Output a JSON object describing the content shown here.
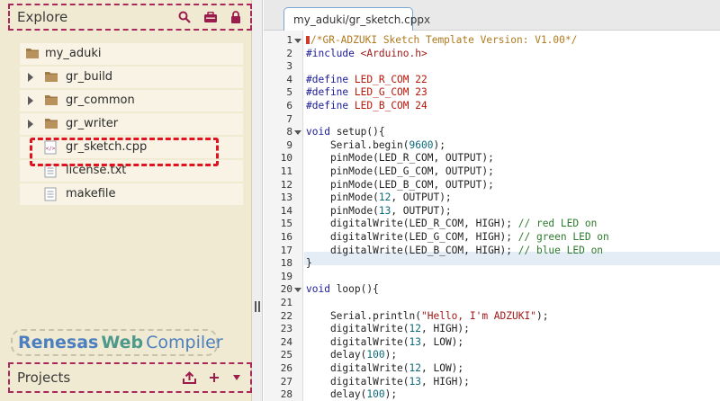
{
  "explore": {
    "title": "Explore",
    "icons": [
      "search-icon",
      "toolbox-icon",
      "lock-icon"
    ]
  },
  "tree": [
    {
      "label": "my_aduki",
      "type": "folder",
      "level": 0,
      "expandable": false
    },
    {
      "label": "gr_build",
      "type": "folder",
      "level": 1,
      "expandable": true
    },
    {
      "label": "gr_common",
      "type": "folder",
      "level": 1,
      "expandable": true
    },
    {
      "label": "gr_writer",
      "type": "folder",
      "level": 1,
      "expandable": true
    },
    {
      "label": "gr_sketch.cpp",
      "type": "code-file",
      "level": 1,
      "expandable": false
    },
    {
      "label": "license.txt",
      "type": "text-file",
      "level": 1,
      "expandable": false
    },
    {
      "label": "makefile",
      "type": "text-file",
      "level": 1,
      "expandable": false
    }
  ],
  "brand": {
    "word1": "Renesas",
    "word2": "Web",
    "word3": "Compiler"
  },
  "projects": {
    "title": "Projects",
    "icons": [
      "upload-icon",
      "plus-icon",
      "dropdown-icon"
    ]
  },
  "editor": {
    "tab_label": "my_aduki/gr_sketch.cpp",
    "tab_close": "x",
    "line_numbers": [
      "1",
      "2",
      "3",
      "4",
      "5",
      "6",
      "7",
      "8",
      "9",
      "10",
      "11",
      "12",
      "13",
      "14",
      "15",
      "16",
      "17",
      "18",
      "19",
      "20",
      "21",
      "22",
      "23",
      "24",
      "25",
      "26",
      "27",
      "28"
    ],
    "fold_lines": [
      "1",
      "8",
      "20"
    ],
    "lines": [
      "/*GR-ADZUKI Sketch Template Version: V1.00*/",
      "#include <Arduino.h>",
      "",
      "#define LED_R_COM 22",
      "#define LED_G_COM 23",
      "#define LED_B_COM 24",
      "",
      "void setup(){",
      "    Serial.begin(9600);",
      "    pinMode(LED_R_COM, OUTPUT);",
      "    pinMode(LED_G_COM, OUTPUT);",
      "    pinMode(LED_B_COM, OUTPUT);",
      "    pinMode(12, OUTPUT);",
      "    pinMode(13, OUTPUT);",
      "    digitalWrite(LED_R_COM, HIGH); // red LED on",
      "    digitalWrite(LED_G_COM, HIGH); // green LED on",
      "    digitalWrite(LED_B_COM, HIGH); // blue LED on",
      "}",
      "",
      "void loop(){",
      "",
      "    Serial.println(\"Hello, I'm ADZUKI\");",
      "    digitalWrite(12, HIGH);",
      "    digitalWrite(13, LOW);",
      "    delay(100);",
      "    digitalWrite(12, LOW);",
      "    digitalWrite(13, HIGH);",
      "    delay(100);"
    ]
  },
  "colors": {
    "panel_bg": "#f1ead2",
    "accent_dashed": "#a8285a",
    "highlight": "#e0141e",
    "tab_border": "#7aa6d2"
  }
}
